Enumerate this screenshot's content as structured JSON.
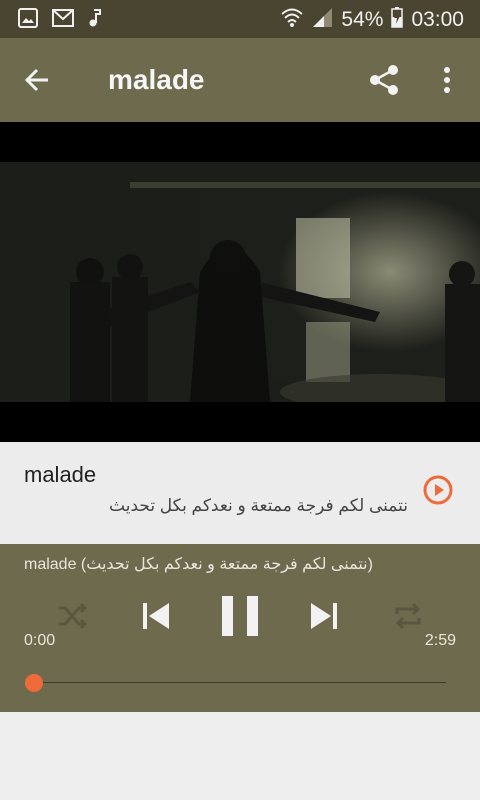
{
  "status_bar": {
    "battery": "54%",
    "time": "03:00",
    "icons": [
      "image-icon",
      "mail-icon",
      "music-icon",
      "wifi-icon",
      "signal-icon",
      "battery-charging-icon"
    ]
  },
  "toolbar": {
    "title": "malade",
    "icons": [
      "back-arrow-icon",
      "share-icon",
      "more-vert-icon"
    ]
  },
  "song": {
    "title": "malade",
    "description": "نتمنى لكم فرجة ممتعة و نعدكم بكل تحديث"
  },
  "player": {
    "now_playing": "malade (نتمنى لكم فرجة ممتعة و نعدكم بكل تحديث)",
    "elapsed": "0:00",
    "duration": "2:59",
    "progress": 0.0,
    "icons": [
      "shuffle-icon",
      "previous-icon",
      "pause-icon",
      "next-icon",
      "repeat-icon"
    ]
  },
  "colors": {
    "status_bar": "#4a4530",
    "toolbar": "#6e6a4e",
    "accent": "#ef6a3b",
    "background": "#eeeeee"
  }
}
